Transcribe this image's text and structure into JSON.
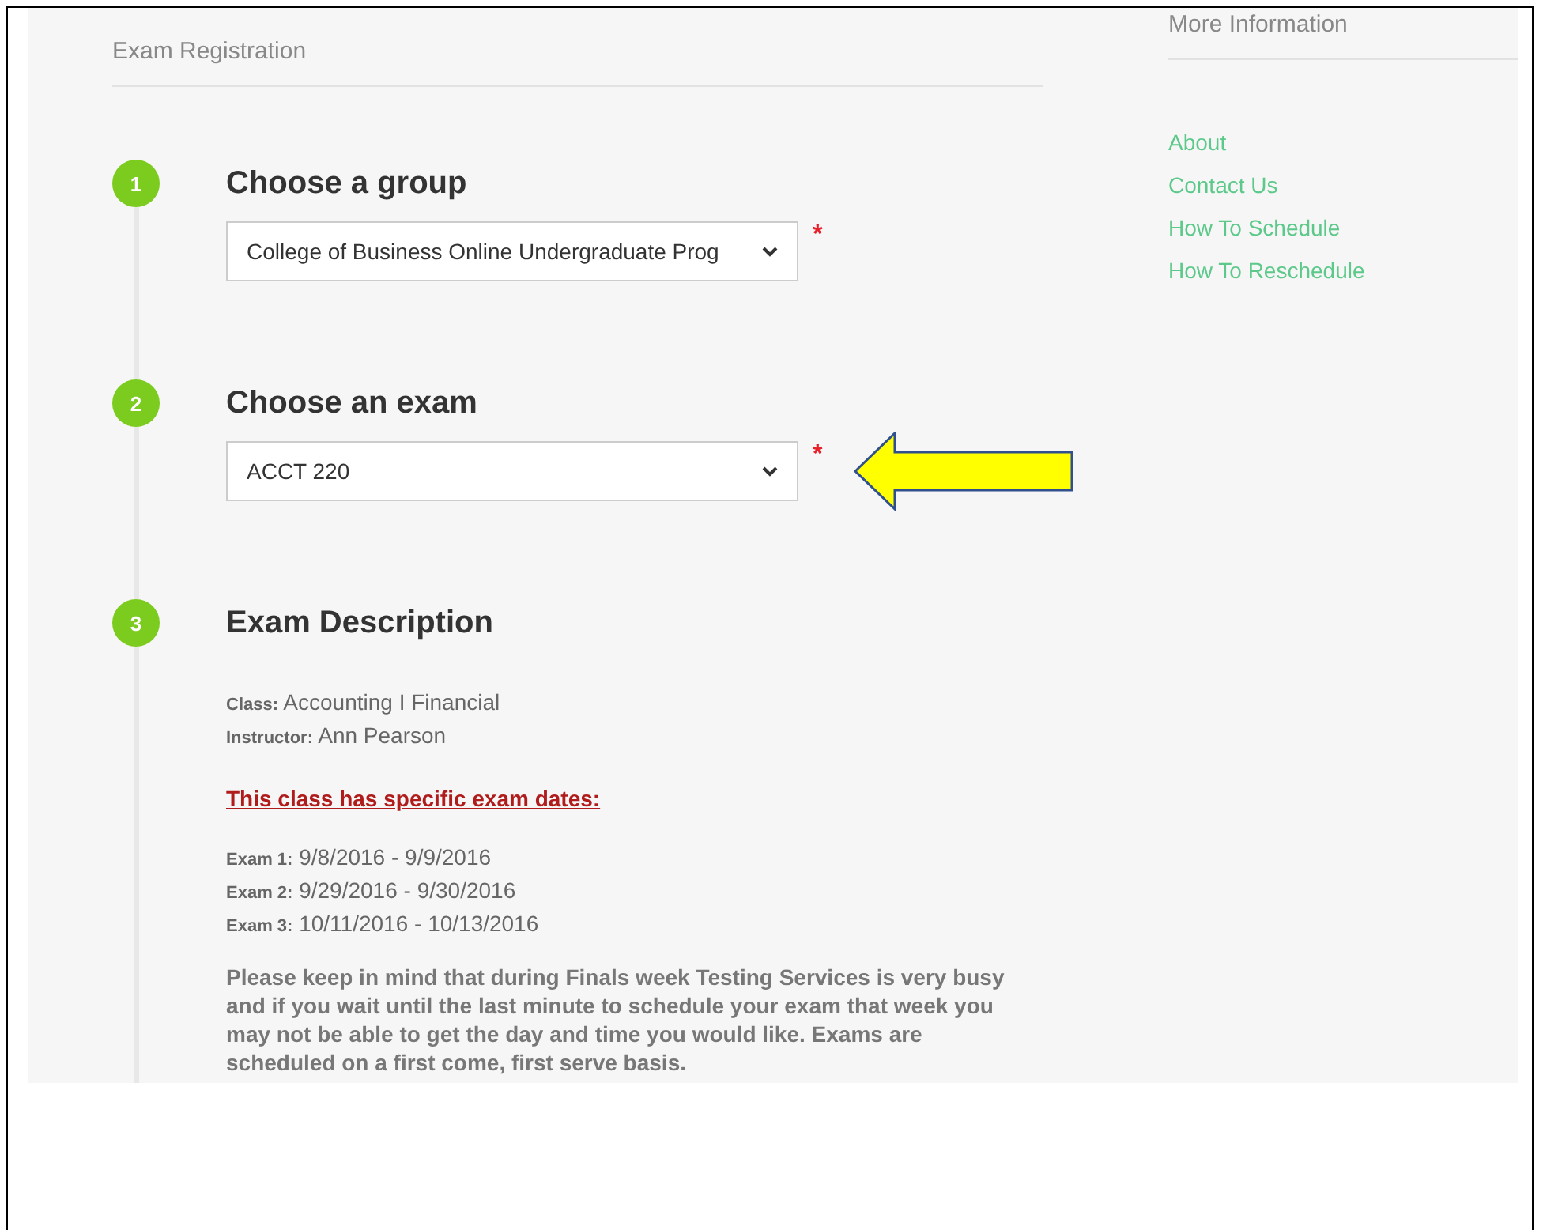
{
  "breadcrumb": "Exam Registration",
  "required_mark": "*",
  "steps": [
    {
      "number": "1",
      "title": "Choose a group",
      "kind": "select",
      "value": "College of Business Online Undergraduate Prog",
      "required": true,
      "highlighted": false
    },
    {
      "number": "2",
      "title": "Choose an exam",
      "kind": "select",
      "value": "ACCT 220",
      "required": true,
      "highlighted": true
    },
    {
      "number": "3",
      "title": "Exam Description",
      "kind": "description"
    }
  ],
  "description": {
    "details": [
      {
        "label": "Class:",
        "value": "Accounting I Financial"
      },
      {
        "label": "Instructor:",
        "value": "Ann Pearson"
      }
    ],
    "notice": "This class has specific exam dates:",
    "exams": [
      {
        "label": "Exam 1:",
        "value": "9/8/2016 - 9/9/2016"
      },
      {
        "label": "Exam 2:",
        "value": "9/29/2016 - 9/30/2016"
      },
      {
        "label": "Exam 3:",
        "value": "10/11/2016 - 10/13/2016"
      }
    ],
    "note": "Please keep in mind that during Finals week Testing Services is very busy and if you wait until the last minute to schedule your exam that week you may not be able to get the day and time you would like. Exams are scheduled on a first come, first serve basis."
  },
  "sidebar": {
    "title": "More Information",
    "links": [
      "About",
      "Contact Us",
      "How To Schedule",
      "How To Reschedule"
    ]
  }
}
